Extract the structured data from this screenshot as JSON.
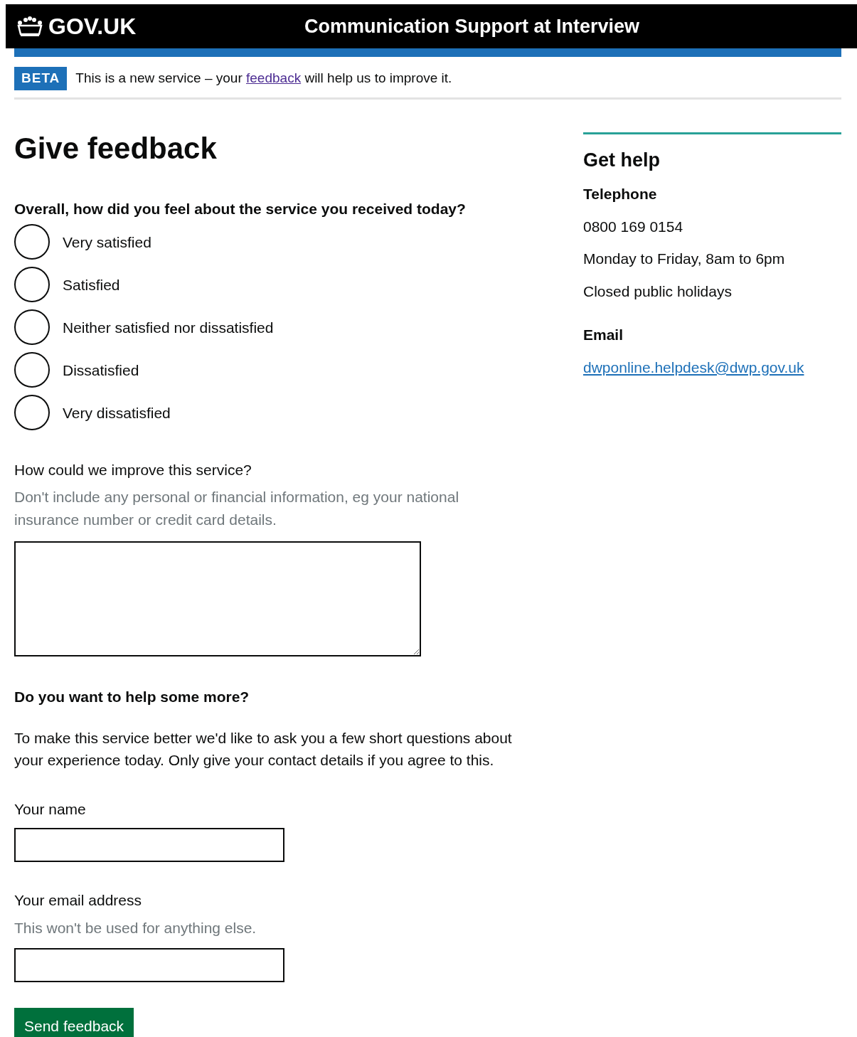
{
  "header": {
    "logo": "GOV.UK",
    "service_name": "Communication Support at Interview"
  },
  "phase_banner": {
    "tag": "BETA",
    "text_before": "This is a new service – your",
    "link": "feedback",
    "text_after": "will help us to improve it."
  },
  "title": "Give feedback",
  "rating": {
    "question": "Overall, how did you feel about the service you received today?",
    "options": [
      {
        "label": "Very satisfied",
        "selected": false
      },
      {
        "label": "Satisfied",
        "selected": false
      },
      {
        "label": "Neither satisfied nor dissatisfied",
        "selected": false
      },
      {
        "label": "Dissatisfied",
        "selected": false
      },
      {
        "label": "Very dissatisfied",
        "selected": false
      }
    ]
  },
  "improve": {
    "label": "How could we improve this service?",
    "hint": "Don't include any personal or financial information, eg your national insurance number or credit card details."
  },
  "more": {
    "heading": "Do you want to help some more?",
    "paragraph": "To make this service better we'd like to ask you a few short questions about your experience today. Only give your contact details if you agree to this.",
    "fields": [
      {
        "label": "Your name"
      },
      {
        "label": "Your email address",
        "hint": "This won't be used for anything else."
      }
    ],
    "button": "Send feedback"
  },
  "sidebar": {
    "heading": "Get help",
    "telephone_label": "Telephone",
    "lines": [
      "0800 169 0154",
      "Monday to Friday, 8am to 6pm",
      "Closed public holidays"
    ],
    "email_label": "Email",
    "email": "dwponline.helpdesk@dwp.gov.uk"
  }
}
